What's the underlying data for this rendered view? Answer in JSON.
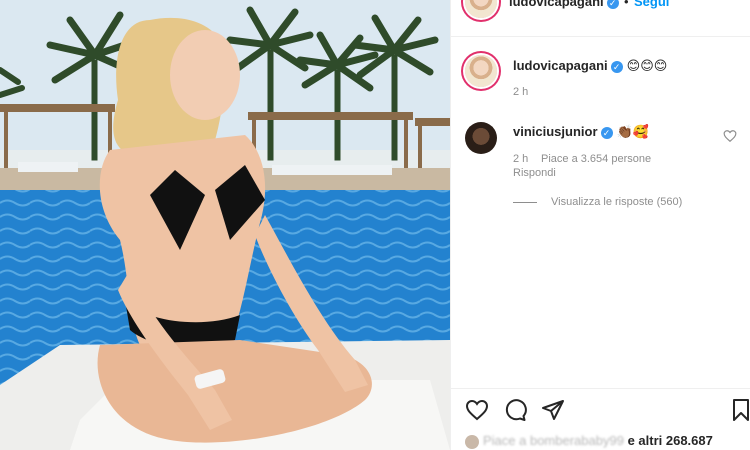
{
  "post": {
    "author": "ludovicapagani",
    "follow_label": "Segui",
    "separator": "•"
  },
  "caption": {
    "username": "ludovicapagani",
    "text": "😊😊😊",
    "time": "2 h"
  },
  "comments": [
    {
      "username": "viniciusjunior",
      "text": "👏🏾🥰",
      "time": "2 h",
      "likes": "Piace a 3.654 persone",
      "reply_label": "Rispondi",
      "view_replies": "Visualizza le risposte (560)"
    }
  ],
  "likes_bar": {
    "liked_by": "Piace a bomberababy99",
    "others": "e altri 268.687"
  },
  "icons": {
    "like": "heart-icon",
    "comment": "comment-icon",
    "share": "paper-plane-icon",
    "save": "bookmark-icon",
    "verified": "verified-badge-icon"
  },
  "colors": {
    "accent": "#0095f6",
    "verified": "#3897f0",
    "muted": "#8e8e8e",
    "text": "#262626"
  }
}
